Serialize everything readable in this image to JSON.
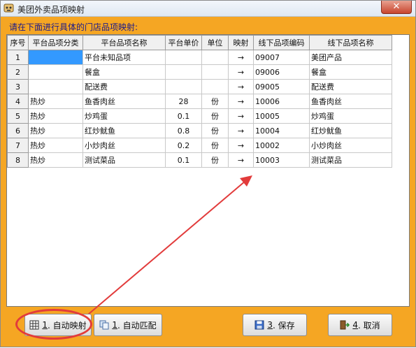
{
  "window": {
    "title": "美团外卖品项映射",
    "close_label": "✕"
  },
  "instruction": "请在下面进行具体的门店品项映射:",
  "grid": {
    "columns": [
      "序号",
      "平台品项分类",
      "平台品项名称",
      "平台单价",
      "单位",
      "映射",
      "线下品项编码",
      "线下品项名称"
    ],
    "rows": [
      {
        "no": "1",
        "category": "",
        "name": "平台未知品项",
        "price": "",
        "unit": "",
        "map": "→",
        "code": "09007",
        "offline_name": "美团产品"
      },
      {
        "no": "2",
        "category": "",
        "name": "餐盒",
        "price": "",
        "unit": "",
        "map": "→",
        "code": "09006",
        "offline_name": "餐盒"
      },
      {
        "no": "3",
        "category": "",
        "name": "配送费",
        "price": "",
        "unit": "",
        "map": "→",
        "code": "09005",
        "offline_name": "配送费"
      },
      {
        "no": "4",
        "category": "热炒",
        "name": "鱼香肉丝",
        "price": "28",
        "unit": "份",
        "map": "→",
        "code": "10006",
        "offline_name": "鱼香肉丝"
      },
      {
        "no": "5",
        "category": "热炒",
        "name": "炒鸡蛋",
        "price": "0.1",
        "unit": "份",
        "map": "→",
        "code": "10005",
        "offline_name": "炒鸡蛋"
      },
      {
        "no": "6",
        "category": "热炒",
        "name": "红炒鱿鱼",
        "price": "0.8",
        "unit": "份",
        "map": "→",
        "code": "10004",
        "offline_name": "红炒鱿鱼"
      },
      {
        "no": "7",
        "category": "热炒",
        "name": "小炒肉丝",
        "price": "0.2",
        "unit": "份",
        "map": "→",
        "code": "10002",
        "offline_name": "小炒肉丝"
      },
      {
        "no": "8",
        "category": "热炒",
        "name": "测试菜品",
        "price": "0.1",
        "unit": "份",
        "map": "→",
        "code": "10003",
        "offline_name": "测试菜品"
      }
    ]
  },
  "buttons": {
    "auto_map": {
      "key": "1",
      "label": ". 自动映射",
      "icon": "grid-icon"
    },
    "auto_match": {
      "key": "1",
      "label": ". 自动匹配",
      "icon": "copy-icon"
    },
    "save": {
      "key": "3",
      "label": ". 保存",
      "icon": "floppy-disk-icon"
    },
    "cancel": {
      "key": "4",
      "label": ". 取消",
      "icon": "exit-door-icon"
    }
  },
  "colors": {
    "window_bg": "#f5a623",
    "selection": "#3399ff",
    "annotation": "#e23b3b",
    "instruction_text": "#1a1a8c"
  }
}
